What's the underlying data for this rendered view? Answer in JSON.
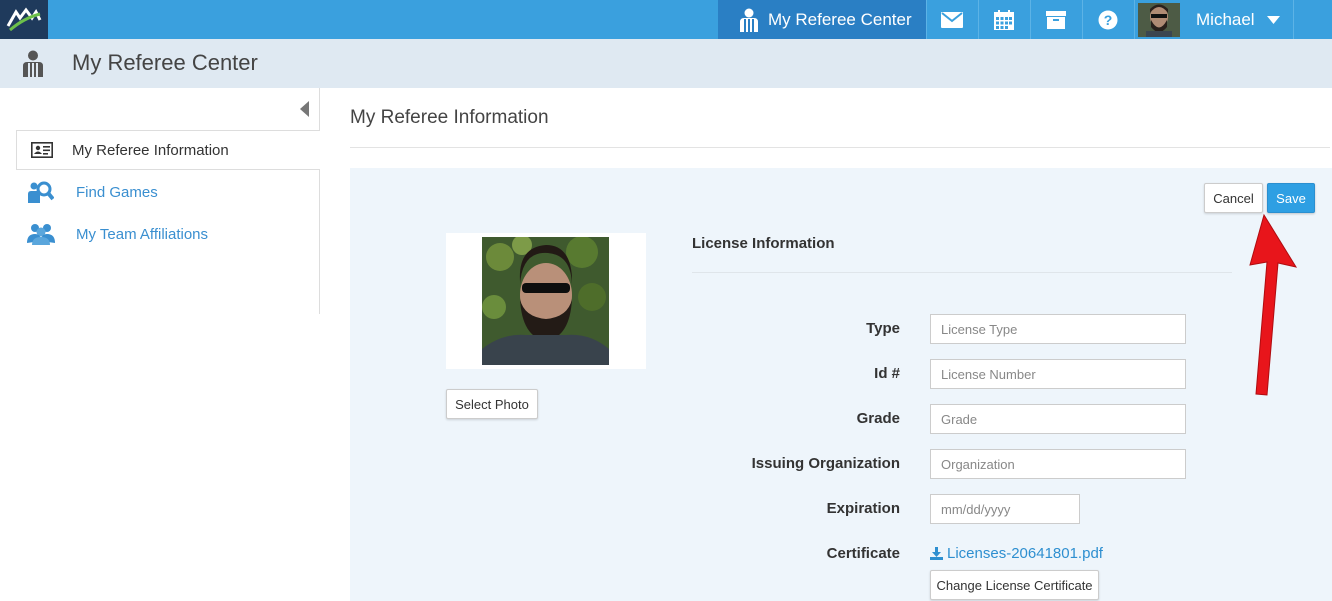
{
  "topbar": {
    "center_label": "My Referee Center",
    "user_name": "Michael",
    "icons": [
      "mail-icon",
      "calendar-icon",
      "archive-icon",
      "help-icon"
    ]
  },
  "subheader": {
    "title": "My Referee Center"
  },
  "sidebar": {
    "items": [
      {
        "label": "My Referee Information",
        "icon": "id-card-icon"
      },
      {
        "label": "Find Games",
        "icon": "search-referee-icon"
      },
      {
        "label": "My Team Affiliations",
        "icon": "team-icon"
      }
    ]
  },
  "main": {
    "title": "My Referee Information",
    "cancel_label": "Cancel",
    "save_label": "Save",
    "select_photo_label": "Select Photo",
    "license": {
      "title": "License Information",
      "fields": [
        {
          "label": "Type",
          "placeholder": "License Type"
        },
        {
          "label": "Id #",
          "placeholder": "License Number"
        },
        {
          "label": "Grade",
          "placeholder": "Grade"
        },
        {
          "label": "Issuing Organization",
          "placeholder": "Organization"
        },
        {
          "label": "Expiration",
          "placeholder": "mm/dd/yyyy"
        }
      ],
      "certificate_label": "Certificate",
      "certificate_file": "Licenses-20641801.pdf",
      "change_certificate_label": "Change License Certificate"
    }
  },
  "colors": {
    "topbar": "#3aa0de",
    "topbar_active": "#2a7fc4",
    "accent_link": "#2e8fd0",
    "primary_button": "#2e9fe3",
    "annotation_arrow": "#e8151b"
  }
}
